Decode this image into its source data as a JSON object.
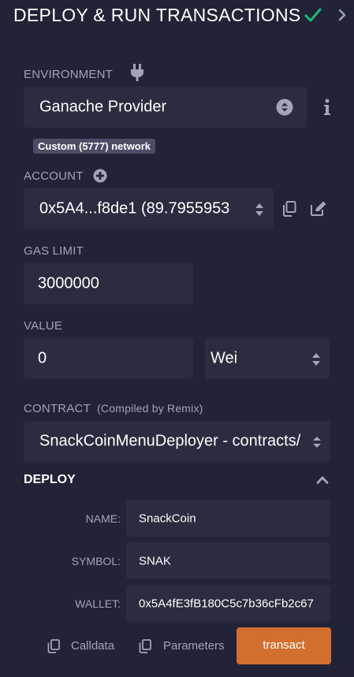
{
  "header": {
    "title": "DEPLOY & RUN TRANSACTIONS"
  },
  "environment": {
    "label": "ENVIRONMENT",
    "value": "Ganache Provider",
    "badge": "Custom (5777) network"
  },
  "account": {
    "label": "ACCOUNT",
    "value": "0x5A4...f8de1 (89.7955953"
  },
  "gas_limit": {
    "label": "GAS LIMIT",
    "value": "3000000"
  },
  "value": {
    "label": "VALUE",
    "amount": "0",
    "unit": "Wei"
  },
  "contract": {
    "label": "CONTRACT",
    "sublabel": "(Compiled by Remix)",
    "value": "SnackCoinMenuDeployer - contracts/"
  },
  "deploy": {
    "label": "DEPLOY",
    "params": [
      {
        "label": "NAME:",
        "value": "SnackCoin"
      },
      {
        "label": "SYMBOL:",
        "value": "SNAK"
      },
      {
        "label": "WALLET:",
        "value": "0x5A4fE3fB180C5c7b36cFb2c67"
      }
    ],
    "calldata_label": "Calldata",
    "parameters_label": "Parameters",
    "transact_label": "transact"
  },
  "colors": {
    "background": "#222336",
    "input": "#2a2c3f",
    "accent": "#d26f2e",
    "success": "#1fb37a"
  }
}
